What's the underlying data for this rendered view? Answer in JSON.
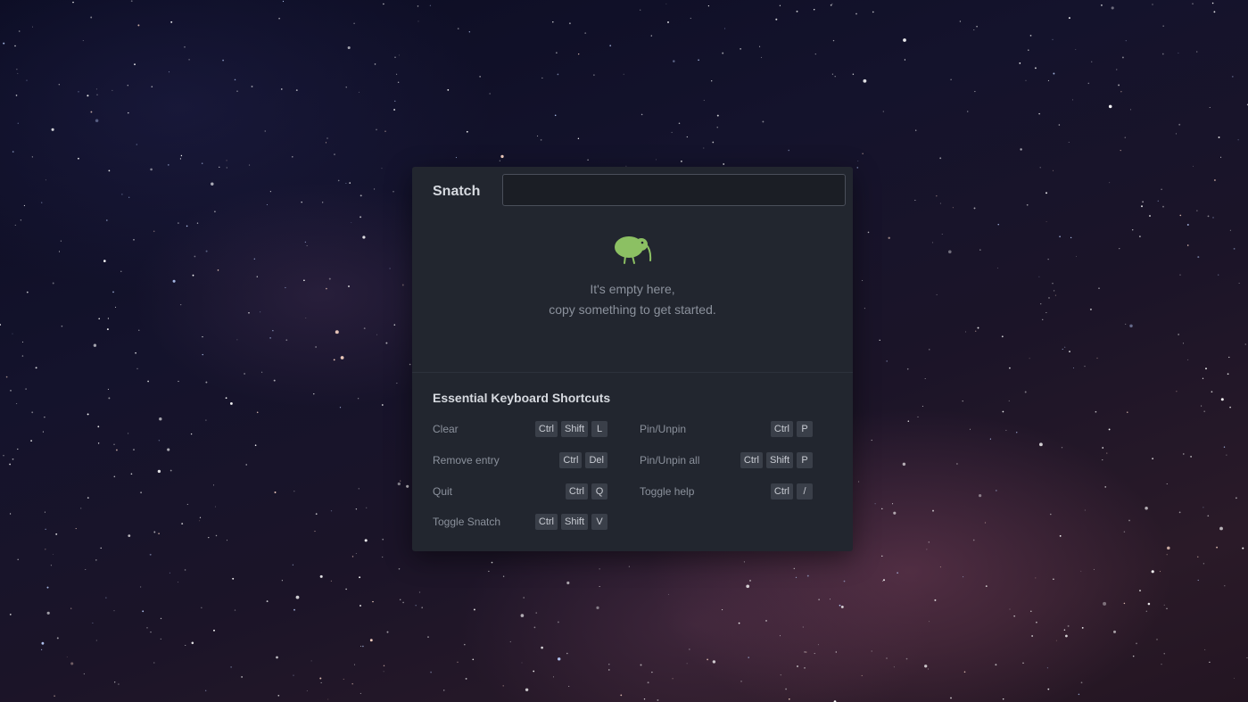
{
  "app": {
    "title": "Snatch"
  },
  "search": {
    "value": "",
    "placeholder": ""
  },
  "empty_state": {
    "icon": "kiwi-icon",
    "line1": "It's empty here,",
    "line2": "copy something to get started."
  },
  "shortcuts": {
    "title": "Essential Keyboard Shortcuts",
    "left": [
      {
        "label": "Clear",
        "keys": [
          "Ctrl",
          "Shift",
          "L"
        ]
      },
      {
        "label": "Remove entry",
        "keys": [
          "Ctrl",
          "Del"
        ]
      },
      {
        "label": "Quit",
        "keys": [
          "Ctrl",
          "Q"
        ]
      },
      {
        "label": "Toggle Snatch",
        "keys": [
          "Ctrl",
          "Shift",
          "V"
        ]
      }
    ],
    "right": [
      {
        "label": "Pin/Unpin",
        "keys": [
          "Ctrl",
          "P"
        ]
      },
      {
        "label": "Pin/Unpin all",
        "keys": [
          "Ctrl",
          "Shift",
          "P"
        ]
      },
      {
        "label": "Toggle help",
        "keys": [
          "Ctrl",
          "/"
        ]
      }
    ]
  },
  "colors": {
    "panel_bg": "#22262f",
    "kiwi_green": "#8cc063",
    "key_bg": "#3a3f49"
  }
}
